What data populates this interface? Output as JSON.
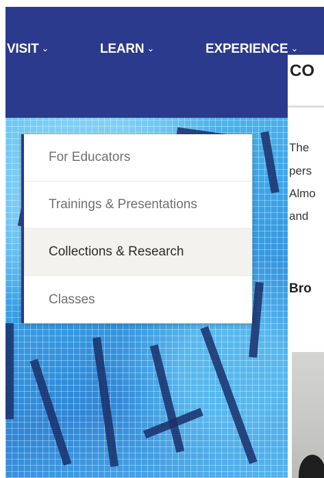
{
  "nav": {
    "items": [
      {
        "label": "VISIT",
        "chevron": "⌄"
      },
      {
        "label": "LEARN",
        "chevron": "⌄"
      },
      {
        "label": "EXPERIENCE",
        "chevron": "⌄"
      }
    ]
  },
  "dropdown": {
    "items": [
      {
        "label": "For Educators"
      },
      {
        "label": "Trainings & Presentations"
      },
      {
        "label": "Collections & Research"
      },
      {
        "label": "Classes"
      }
    ]
  },
  "content": {
    "title": "CO",
    "lines": [
      "The",
      "pers",
      "Almo",
      "and"
    ],
    "subheading": "Bro"
  },
  "colors": {
    "nav_bg": "#2b3a8c",
    "dropdown_active_bg": "#f4f2ef"
  }
}
